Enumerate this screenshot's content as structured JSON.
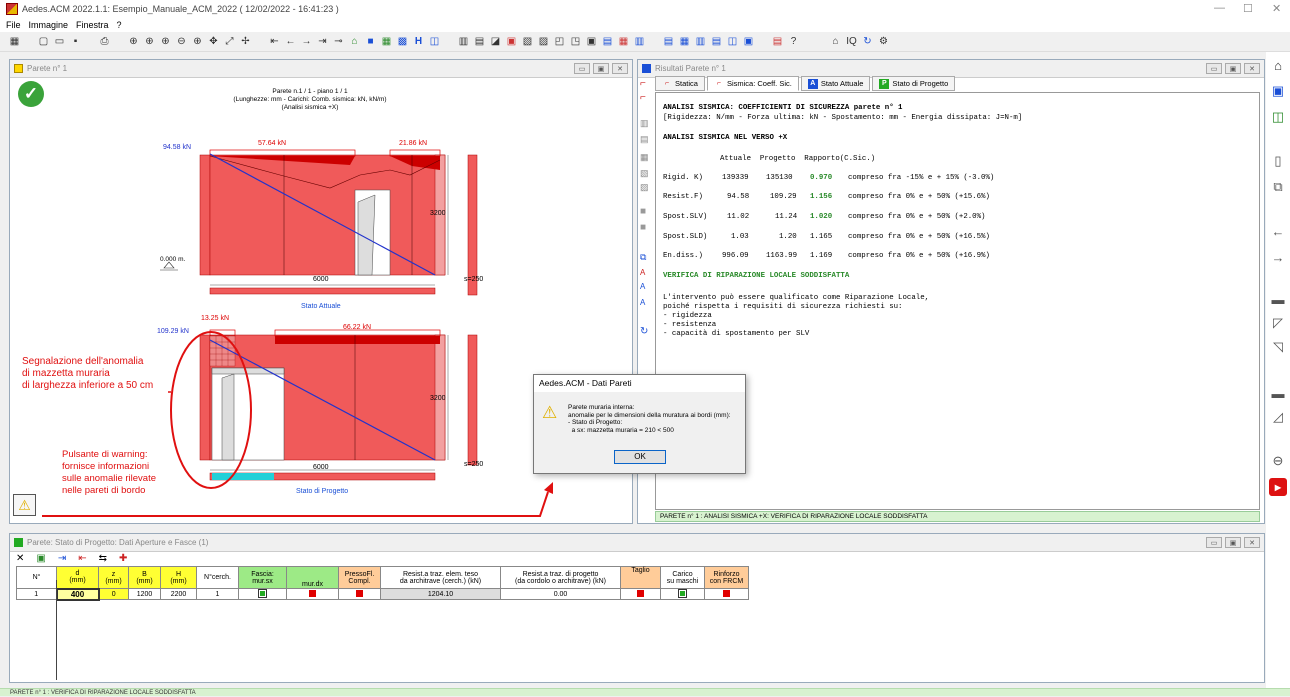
{
  "window": {
    "title": "Aedes.ACM 2022.1.1: Esempio_Manuale_ACM_2022  ( 12/02/2022 - 16:41:23 )",
    "minimize": "—",
    "maximize": "☐",
    "close": "✕"
  },
  "menu": [
    "File",
    "Immagine",
    "Finestra",
    "?"
  ],
  "left_window": {
    "title": "Parete n° 1",
    "header_lines": [
      "Parete n.1 / 1 - piano 1 / 1",
      "(Lunghezze: mm - Carichi: Comb. sismica: kN, kN/m)",
      "(Analisi sismica +X)"
    ],
    "top_diagram": {
      "force_label": "94.58 kN",
      "load1": "57.64 kN",
      "load2": "21.86 kN",
      "elevation": "0.000 m.",
      "height": "3200",
      "length": "6000",
      "thickness": "s=250",
      "caption": "Stato Attuale"
    },
    "bottom_diagram": {
      "force_label": "109.29 kN",
      "load1": "13.25 kN",
      "load2": "66.22 kN",
      "height": "3200",
      "length": "6000",
      "thickness": "s=250",
      "caption": "Stato di Progetto"
    },
    "annotation1": "Segnalazione dell'anomalia\ndi mazzetta muraria\ndi larghezza inferiore a 50 cm",
    "annotation2": "Pulsante di warning:\nfornisce informazioni\nsulle anomalie rilevate\nnelle pareti di bordo"
  },
  "right_window": {
    "title": "Risultati Parete n° 1",
    "tabs": [
      {
        "label": "Statica",
        "color": "#cc2222"
      },
      {
        "label": "Sismica: Coeff. Sic.",
        "color": "#cc2222"
      },
      {
        "label": "Stato Attuale",
        "color": "#1a4fd6",
        "letter": "A"
      },
      {
        "label": "Stato di Progetto",
        "color": "#22aa22",
        "letter": "P"
      }
    ],
    "heading": "ANALISI SISMICA: COEFFICIENTI DI SICUREZZA parete n° 1",
    "units": "[Rigidezza: N/mm - Forza ultima: kN - Spostamento: mm - Energia dissipata: J=N-m]",
    "direction": "ANALISI SISMICA NEL VERSO +X",
    "col_headers": "Attuale  Progetto  Rapporto(C.Sic.)",
    "rows": [
      {
        "label": "Rigid. K)",
        "attuale": "139339",
        "progetto": "135130",
        "rapporto": "0.970",
        "note": "compreso fra -15% e + 15% (-3.0%)",
        "ok": true
      },
      {
        "label": "Resist.F)",
        "attuale": "94.58",
        "progetto": "109.29",
        "rapporto": "1.156",
        "note": "compreso fra 0% e + 50% (+15.6%)",
        "ok": true
      },
      {
        "label": "Spost.SLV)",
        "attuale": "11.02",
        "progetto": "11.24",
        "rapporto": "1.020",
        "note": "compreso fra 0% e + 50% (+2.0%)",
        "ok": true
      },
      {
        "label": "Spost.SLD)",
        "attuale": "1.03",
        "progetto": "1.20",
        "rapporto": "1.165",
        "note": "compreso fra 0% e + 50% (+16.5%)",
        "ok": false
      },
      {
        "label": "En.diss.)",
        "attuale": "996.09",
        "progetto": "1163.99",
        "rapporto": "1.169",
        "note": "compreso fra 0% e + 50% (+16.9%)",
        "ok": false
      }
    ],
    "verdict": "VERIFICA DI RIPARAZIONE LOCALE SODDISFATTA",
    "paragraph": "L'intervento può essere qualificato come Riparazione Locale,\npoiché rispetta i requisiti di sicurezza richiesti su:\n- rigidezza\n- resistenza\n- capacità di spostamento per SLV",
    "status": "PARETE n° 1 : ANALISI SISMICA +X:  VERIFICA DI RIPARAZIONE LOCALE SODDISFATTA"
  },
  "dialog": {
    "title": "Aedes.ACM - Dati Pareti",
    "message": "Parete muraria interna:\nanomalie per le dimensioni della muratura ai bordi (mm):\n- Stato di Progetto:\n  a sx: mazzetta muraria = 210 < 500",
    "ok": "OK"
  },
  "bottom_window": {
    "title": "Parete:  Stato di Progetto:  Dati Aperture e Fasce (1)",
    "headers": [
      "N°",
      "d\n(mm)",
      "z\n(mm)",
      "B\n(mm)",
      "H\n(mm)",
      "N°cerch.",
      "Fascia:\nmur.sx",
      "mur.dx",
      "PressoFl.\nCompl.",
      "Resist.a traz. elem. teso\nda architrave (cerch.) (kN)",
      "Resist.a traz. di progetto\n(da cordolo o architrave) (kN)",
      "Taglio",
      "Carico\nsu maschi",
      "Rinforzo\ncon FRCM"
    ],
    "row": [
      "1",
      "400",
      "0",
      "1200",
      "2200",
      "1",
      "",
      "",
      "",
      "1204.10",
      "0.00",
      "",
      "",
      ""
    ]
  },
  "statusbar": "PARETE n° 1 : VERIFICA DI RIPARAZIONE LOCALE SODDISFATTA",
  "colors": {
    "wall": "#f05a5a",
    "annotation": "#e01010",
    "ok_green": "#2a8a2a"
  }
}
